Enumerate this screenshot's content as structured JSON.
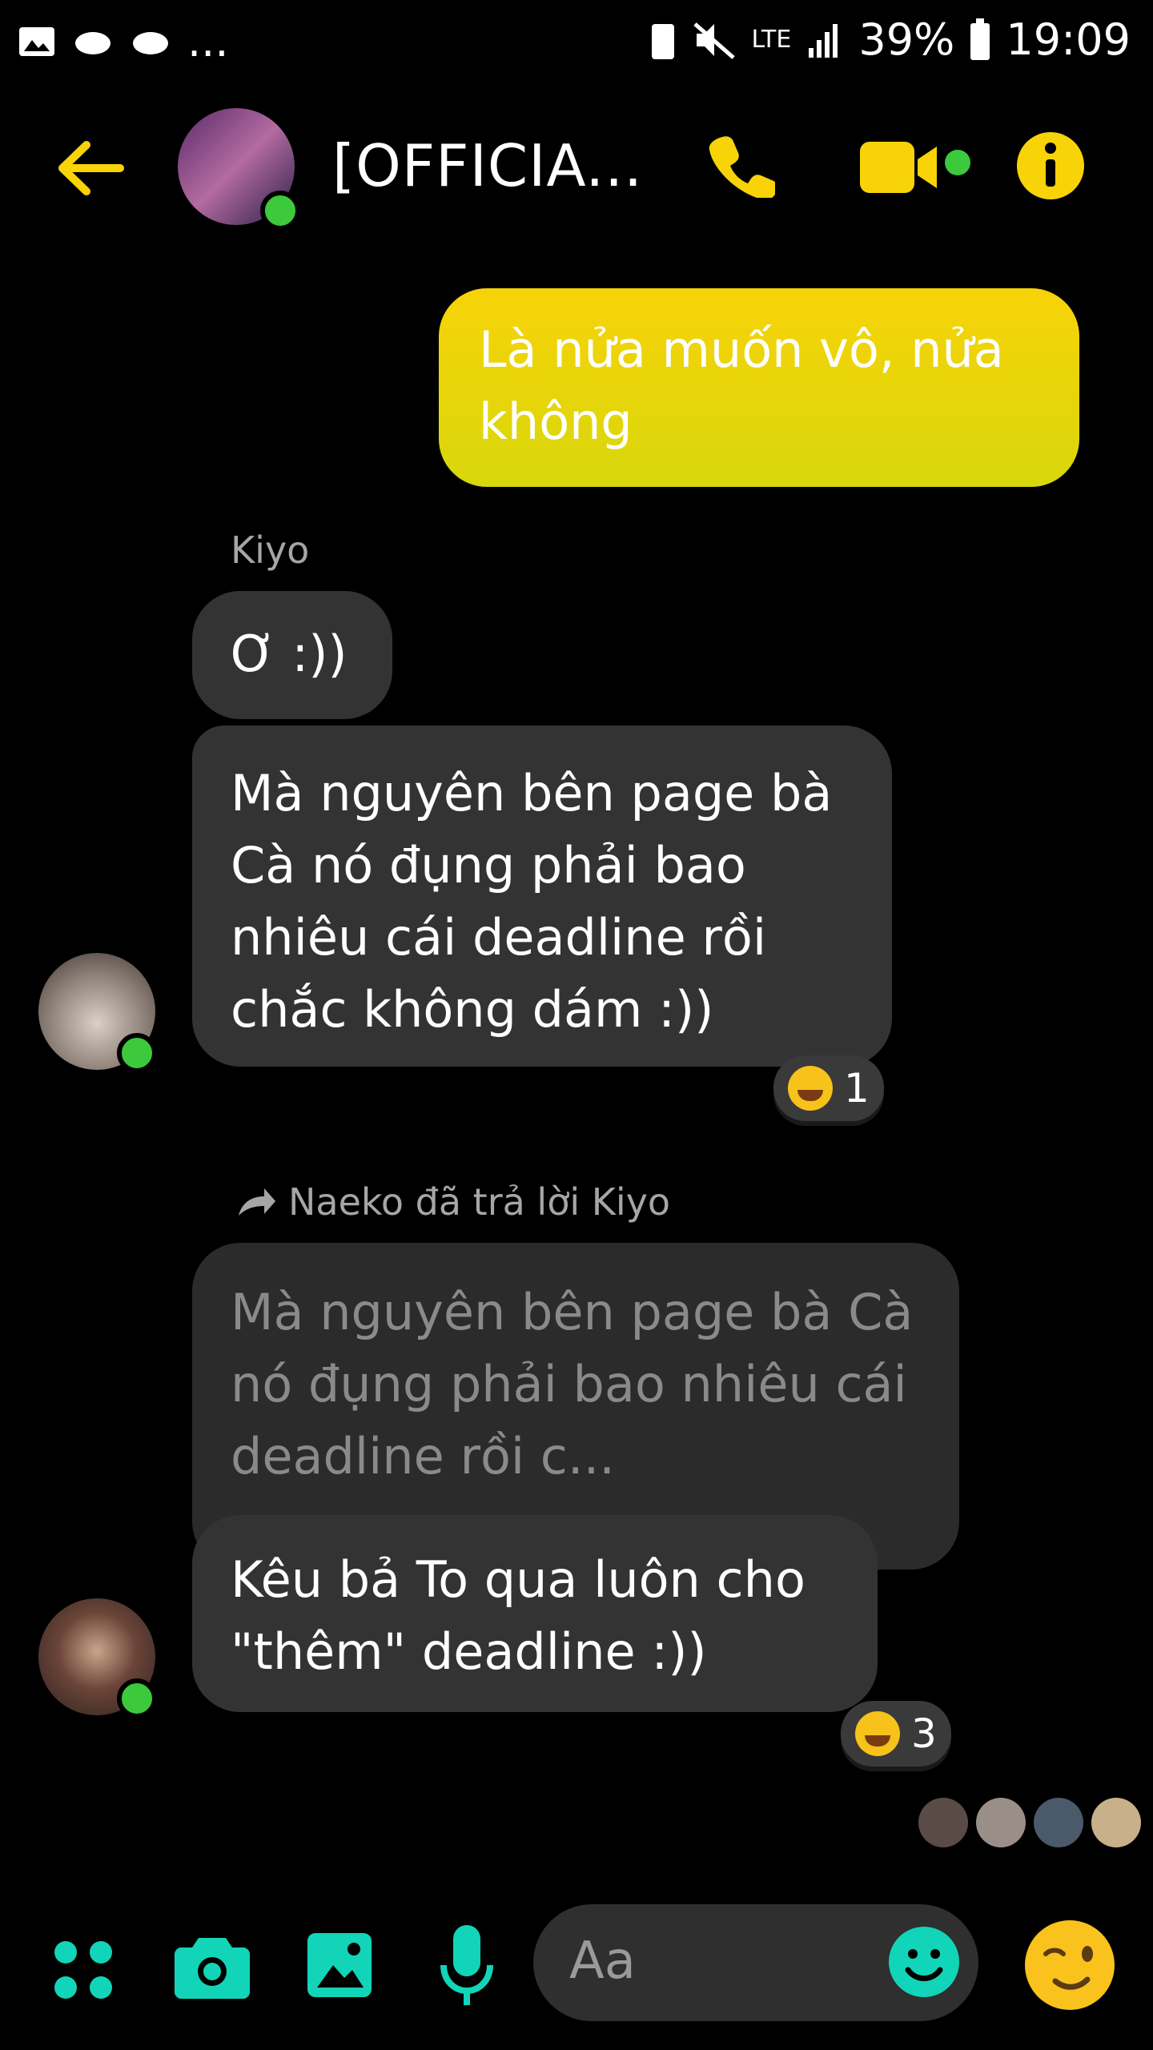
{
  "status_bar": {
    "network": "LTE",
    "battery": "39%",
    "time": "19:09",
    "left_more": "..."
  },
  "header": {
    "title": "[OFFICIA...",
    "icons": [
      "back-arrow-icon",
      "phone-icon",
      "video-camera-icon",
      "info-icon"
    ]
  },
  "messages": {
    "outgoing": "Là nửa muốn vô, nửa không",
    "incoming": [
      {
        "sender": "Kiyo",
        "short": "Ơ :))",
        "long": "Mà nguyên bên page bà Cà nó đụng phải bao nhiêu cái deadline rồi chắc không dám :))",
        "reaction_count": "1"
      },
      {
        "reply_note": "Naeko đã trả lời Kiyo",
        "quoted": "Mà nguyên bên page bà Cà nó đụng phải bao nhiêu cái deadline rồi c...",
        "reply": "Kêu bả To qua luôn cho \"thêm\" deadline :))",
        "reaction_count": "3"
      }
    ]
  },
  "composer": {
    "placeholder": "Aa",
    "icons": [
      "apps-icon",
      "camera-icon",
      "gallery-icon",
      "mic-icon",
      "smile-icon",
      "wink-emoji-icon"
    ]
  },
  "colors": {
    "accent_yellow": "#f7d308",
    "accent_teal": "#12d4b8",
    "bubble_dark": "#333333"
  }
}
